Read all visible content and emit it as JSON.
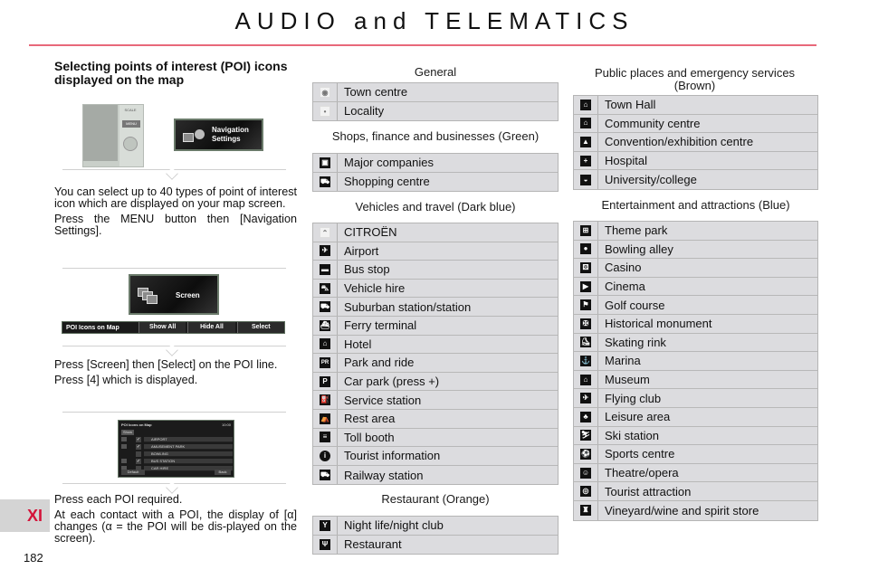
{
  "header": {
    "title": "AUDIO and TELEMATICS"
  },
  "left": {
    "heading": "Selecting points of interest (POI) icons displayed on the map",
    "step1": [
      "You can select up to 40 types of point of interest icon which are displayed on your map screen.",
      "Press the MENU button then [Navigation Settings]."
    ],
    "step2": [
      "Press [Screen] then [Select] on the POI line.",
      "Press [4] which is displayed."
    ],
    "step3": [
      "Press each POI required.",
      "At each contact with a POI, the display of [α] changes (α = the POI will be dis-played on the screen)."
    ],
    "device": {
      "scale_label": "SCALE",
      "menu_label": "MENU"
    },
    "nav_settings_button": {
      "line1": "Navigation",
      "line2": "Settings"
    },
    "screen_button": {
      "label": "Screen"
    },
    "poi_bar": {
      "label": "POI Icons on Map",
      "buttons": [
        "Show All",
        "Hide All",
        "Select"
      ]
    },
    "poi_list_screen": {
      "title": "POI Icons on Map",
      "time": "10:00",
      "show_label": "Show",
      "rows": [
        "AIRPORT",
        "AMUSEMENT PARK",
        "BOWLING",
        "BUS STATION",
        "CAR HIRE"
      ],
      "checked": [
        true,
        true,
        false,
        true,
        false
      ],
      "default_label": "Default",
      "back_label": "Back"
    }
  },
  "categories": {
    "general": {
      "label": "General",
      "items": [
        {
          "icon": "town-centre-icon",
          "glyph": "◉",
          "label": "Town centre"
        },
        {
          "icon": "locality-icon",
          "glyph": "•",
          "label": "Locality"
        }
      ]
    },
    "shops": {
      "label": "Shops, finance and businesses (Green)",
      "items": [
        {
          "icon": "major-companies-icon",
          "glyph": "▣",
          "label": "Major companies"
        },
        {
          "icon": "shopping-cart-icon",
          "glyph": "⛟",
          "label": "Shopping centre"
        }
      ]
    },
    "vehicles": {
      "label": "Vehicles and travel (Dark blue)",
      "items": [
        {
          "icon": "citroen-chevrons-icon",
          "glyph": "⌃",
          "label": "CITROËN"
        },
        {
          "icon": "airport-icon",
          "glyph": "✈",
          "label": "Airport"
        },
        {
          "icon": "bus-stop-icon",
          "glyph": "▬",
          "label": "Bus stop"
        },
        {
          "icon": "vehicle-hire-icon",
          "glyph": "⛍",
          "label": "Vehicle hire"
        },
        {
          "icon": "suburban-station-icon",
          "glyph": "⛟",
          "label": "Suburban station/station"
        },
        {
          "icon": "ferry-terminal-icon",
          "glyph": "⛴",
          "label": "Ferry terminal"
        },
        {
          "icon": "hotel-icon",
          "glyph": "⌂",
          "label": "Hotel"
        },
        {
          "icon": "park-and-ride-icon",
          "glyph": "PR",
          "label": "Park and ride"
        },
        {
          "icon": "car-park-icon",
          "glyph": "P",
          "label": "Car park (press +)"
        },
        {
          "icon": "service-station-icon",
          "glyph": "⛽",
          "label": "Service station"
        },
        {
          "icon": "rest-area-icon",
          "glyph": "⛺",
          "label": "Rest area"
        },
        {
          "icon": "toll-booth-icon",
          "glyph": "≡",
          "label": "Toll booth"
        },
        {
          "icon": "tourist-information-icon",
          "glyph": "i",
          "label": "Tourist information"
        },
        {
          "icon": "railway-station-icon",
          "glyph": "⛟",
          "label": "Railway station"
        }
      ]
    },
    "restaurant": {
      "label": "Restaurant (Orange)",
      "items": [
        {
          "icon": "cocktail-glass-icon",
          "glyph": "Y",
          "label": "Night life/night club"
        },
        {
          "icon": "fork-knife-icon",
          "glyph": "Ψ",
          "label": "Restaurant"
        }
      ]
    },
    "public": {
      "label": "Public places and emergency services (Brown)",
      "items": [
        {
          "icon": "town-hall-icon",
          "glyph": "⌂",
          "label": "Town Hall"
        },
        {
          "icon": "community-centre-icon",
          "glyph": "⌂",
          "label": "Community centre"
        },
        {
          "icon": "convention-centre-icon",
          "glyph": "▲",
          "label": "Convention/exhibition centre"
        },
        {
          "icon": "hospital-icon",
          "glyph": "+",
          "label": "Hospital"
        },
        {
          "icon": "university-icon",
          "glyph": "◒",
          "label": "University/college"
        }
      ]
    },
    "entertainment": {
      "label": "Entertainment and attractions (Blue)",
      "items": [
        {
          "icon": "theme-park-icon",
          "glyph": "⊞",
          "label": "Theme park"
        },
        {
          "icon": "bowling-icon",
          "glyph": "●",
          "label": "Bowling alley"
        },
        {
          "icon": "casino-dice-icon",
          "glyph": "⚄",
          "label": "Casino"
        },
        {
          "icon": "cinema-camera-icon",
          "glyph": "▶",
          "label": "Cinema"
        },
        {
          "icon": "golf-flag-icon",
          "glyph": "⚑",
          "label": "Golf course"
        },
        {
          "icon": "historical-monument-icon",
          "glyph": "✠",
          "label": "Historical monument"
        },
        {
          "icon": "skating-rink-icon",
          "glyph": "⛸",
          "label": "Skating rink"
        },
        {
          "icon": "anchor-icon",
          "glyph": "⚓",
          "label": "Marina"
        },
        {
          "icon": "museum-icon",
          "glyph": "⌂",
          "label": "Museum"
        },
        {
          "icon": "flying-club-icon",
          "glyph": "✈",
          "label": "Flying club"
        },
        {
          "icon": "leisure-area-icon",
          "glyph": "♣",
          "label": "Leisure area"
        },
        {
          "icon": "skier-icon",
          "glyph": "⛷",
          "label": "Ski station"
        },
        {
          "icon": "sports-centre-icon",
          "glyph": "⚽",
          "label": "Sports centre"
        },
        {
          "icon": "theatre-masks-icon",
          "glyph": "☺",
          "label": "Theatre/opera"
        },
        {
          "icon": "tourist-attraction-eye-icon",
          "glyph": "◎",
          "label": "Tourist attraction"
        },
        {
          "icon": "wine-bottle-icon",
          "glyph": "♜",
          "label": "Vineyard/wine and spirit store"
        }
      ]
    }
  },
  "footer": {
    "chapter": "XI",
    "page_number": "182"
  },
  "colors": {
    "accent_rule": "#e8687a",
    "chapter_red": "#d4143a",
    "table_bg": "#dcdcdf"
  }
}
